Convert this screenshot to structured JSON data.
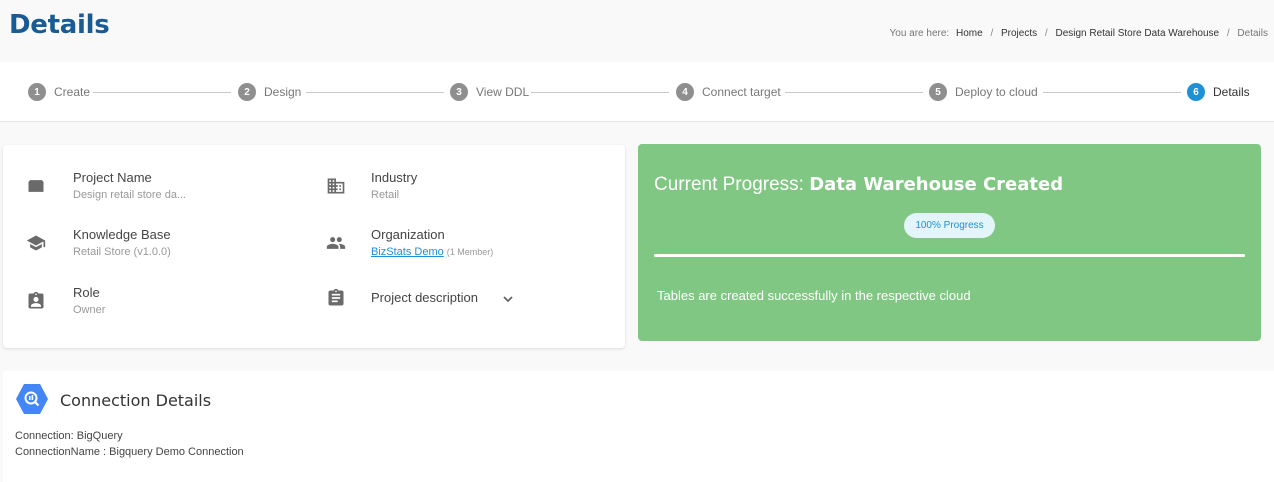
{
  "header": {
    "title": "Details",
    "breadcrumb": {
      "prefix": "You are here:",
      "items": [
        "Home",
        "Projects",
        "Design Retail Store Data Warehouse"
      ],
      "current": "Details",
      "separator": "/"
    }
  },
  "stepper": {
    "steps": [
      {
        "number": "1",
        "label": "Create"
      },
      {
        "number": "2",
        "label": "Design"
      },
      {
        "number": "3",
        "label": "View DDL"
      },
      {
        "number": "4",
        "label": "Connect target"
      },
      {
        "number": "5",
        "label": "Deploy to cloud"
      },
      {
        "number": "6",
        "label": "Details"
      }
    ],
    "active_step": 6,
    "active_color": "#1e90d6"
  },
  "project_info": {
    "project_name": {
      "title": "Project Name",
      "value": "Design retail store da...",
      "icon": "folder-icon"
    },
    "industry": {
      "title": "Industry",
      "value": "Retail",
      "icon": "building-icon"
    },
    "knowledge_base": {
      "title": "Knowledge Base",
      "value": "Retail Store (v1.0.0)",
      "icon": "school-icon"
    },
    "organization": {
      "title": "Organization",
      "link": "BizStats Demo",
      "members": "(1 Member)",
      "icon": "people-icon"
    },
    "role": {
      "title": "Role",
      "value": "Owner",
      "icon": "badge-icon"
    },
    "description": {
      "title": "Project description",
      "icon": "clipboard-icon"
    }
  },
  "progress": {
    "label": "Current Progress:",
    "status": "Data Warehouse Created",
    "pill": "100% Progress",
    "percent": 100,
    "message": "Tables are created successfully in the respective cloud",
    "card_color": "#81c784"
  },
  "connection": {
    "title": "Connection Details",
    "icon": "bigquery-icon",
    "connection_line": "Connection: BigQuery",
    "name_line": "ConnectionName : Bigquery Demo Connection"
  }
}
